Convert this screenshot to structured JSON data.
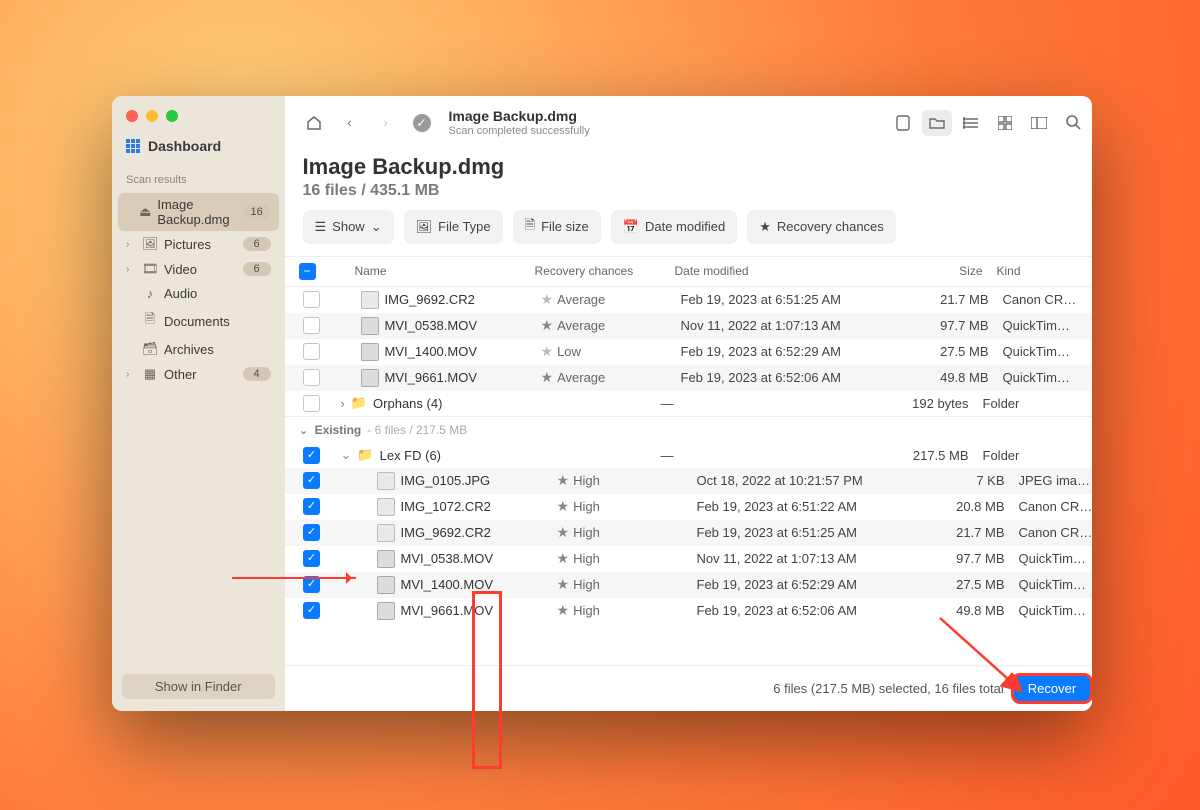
{
  "sidebar": {
    "dashboard": "Dashboard",
    "section": "Scan results",
    "items": [
      {
        "label": "Image Backup.dmg",
        "count": "16",
        "icon": "disk",
        "sel": true,
        "chev": ""
      },
      {
        "label": "Pictures",
        "count": "6",
        "icon": "pic",
        "chev": "›"
      },
      {
        "label": "Video",
        "count": "6",
        "icon": "vid",
        "chev": "›"
      },
      {
        "label": "Audio",
        "count": "",
        "icon": "aud",
        "chev": ""
      },
      {
        "label": "Documents",
        "count": "",
        "icon": "docc",
        "chev": ""
      },
      {
        "label": "Archives",
        "count": "",
        "icon": "arch",
        "chev": ""
      },
      {
        "label": "Other",
        "count": "4",
        "icon": "oth",
        "chev": "›"
      }
    ],
    "show_in_finder": "Show in Finder"
  },
  "top": {
    "title": "Image Backup.dmg",
    "subtitle": "Scan completed successfully"
  },
  "header": {
    "title": "Image Backup.dmg",
    "subtitle": "16 files / 435.1 MB"
  },
  "pills": {
    "show": "Show",
    "filetype": "File Type",
    "filesize": "File size",
    "datemod": "Date modified",
    "recchance": "Recovery chances"
  },
  "cols": {
    "name": "Name",
    "rec": "Recovery chances",
    "date": "Date modified",
    "size": "Size",
    "kind": "Kind"
  },
  "rows_a": [
    {
      "name": "IMG_9692.CR2",
      "rec": "Average",
      "date": "Feb 19, 2023 at 6:51:25 AM",
      "size": "21.7 MB",
      "kind": "Canon CR…",
      "ri": "doc",
      "sf": false
    },
    {
      "name": "MVI_0538.MOV",
      "rec": "Average",
      "date": "Nov 11, 2022 at 1:07:13 AM",
      "size": "97.7 MB",
      "kind": "QuickTim…",
      "ri": "mov",
      "sf": true
    },
    {
      "name": "MVI_1400.MOV",
      "rec": "Low",
      "date": "Feb 19, 2023 at 6:52:29 AM",
      "size": "27.5 MB",
      "kind": "QuickTim…",
      "ri": "mov",
      "sf": false
    },
    {
      "name": "MVI_9661.MOV",
      "rec": "Average",
      "date": "Feb 19, 2023 at 6:52:06 AM",
      "size": "49.8 MB",
      "kind": "QuickTim…",
      "ri": "mov",
      "sf": true
    }
  ],
  "orphans": {
    "label": "Orphans (4)",
    "date": "—",
    "size": "192 bytes",
    "kind": "Folder"
  },
  "group": {
    "label": "Existing",
    "detail": "6 files / 217.5 MB"
  },
  "lexfd": {
    "label": "Lex FD (6)",
    "date": "—",
    "size": "217.5 MB",
    "kind": "Folder"
  },
  "rows_b": [
    {
      "name": "IMG_0105.JPG",
      "rec": "High",
      "date": "Oct 18, 2022 at 10:21:57 PM",
      "size": "7 KB",
      "kind": "JPEG ima…",
      "ri": "doc"
    },
    {
      "name": "IMG_1072.CR2",
      "rec": "High",
      "date": "Feb 19, 2023 at 6:51:22 AM",
      "size": "20.8 MB",
      "kind": "Canon CR…",
      "ri": "doc"
    },
    {
      "name": "IMG_9692.CR2",
      "rec": "High",
      "date": "Feb 19, 2023 at 6:51:25 AM",
      "size": "21.7 MB",
      "kind": "Canon CR…",
      "ri": "doc"
    },
    {
      "name": "MVI_0538.MOV",
      "rec": "High",
      "date": "Nov 11, 2022 at 1:07:13 AM",
      "size": "97.7 MB",
      "kind": "QuickTim…",
      "ri": "mov"
    },
    {
      "name": "MVI_1400.MOV",
      "rec": "High",
      "date": "Feb 19, 2023 at 6:52:29 AM",
      "size": "27.5 MB",
      "kind": "QuickTim…",
      "ri": "mov"
    },
    {
      "name": "MVI_9661.MOV",
      "rec": "High",
      "date": "Feb 19, 2023 at 6:52:06 AM",
      "size": "49.8 MB",
      "kind": "QuickTim…",
      "ri": "mov"
    }
  ],
  "footer": {
    "status": "6 files (217.5 MB) selected, 16 files total",
    "recover": "Recover"
  }
}
